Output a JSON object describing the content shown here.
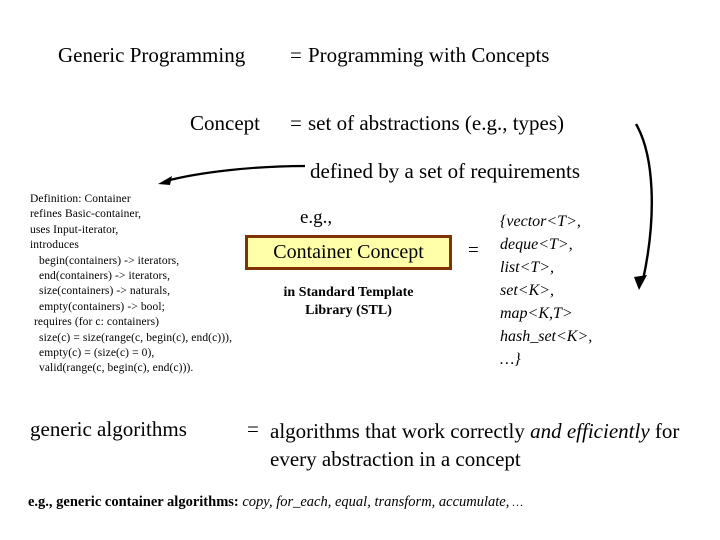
{
  "slide": {
    "background_color": "#ffffff",
    "text_color": "#000000"
  },
  "headline": {
    "term1": "Generic Programming",
    "equals1": "=",
    "definition1": "Programming with Concepts",
    "term2": "Concept",
    "equals2": "=",
    "definition2": "set of abstractions (e.g., types)",
    "definition2_cont": "defined by a set of requirements"
  },
  "definition_block": {
    "lines": [
      "Definition: Container",
      "refines Basic-container,",
      "uses Input-iterator,",
      "introduces",
      "begin(containers) -> iterators,",
      "end(containers) -> iterators,",
      "size(containers) -> naturals,",
      "empty(containers) -> bool;",
      "requires (for c: containers)",
      "size(c) = size(range(c, begin(c), end(c))),",
      "empty(c) = (size(c) = 0),",
      "valid(range(c, begin(c), end(c)))."
    ],
    "indents": [
      0,
      0,
      0,
      0,
      1,
      1,
      1,
      1,
      2,
      1,
      1,
      1
    ]
  },
  "example": {
    "eg_label": "e.g.,",
    "box_label": "Container Concept",
    "box_fill": "#ffffaa",
    "box_border": "#803300",
    "caption_line1": "in Standard Template",
    "caption_line2": "Library (STL)",
    "equals": "="
  },
  "type_list": {
    "items": [
      "{vector<T>,",
      "deque<T>,",
      "list<T>,",
      "set<K>,",
      "map<K,T>",
      "hash_set<K>,",
      "…}"
    ]
  },
  "bottom": {
    "term": "generic algorithms",
    "equals": "=",
    "text_part1": "algorithms that work correctly ",
    "text_italic": "and efficiently",
    "text_part2": " for every abstraction in a concept"
  },
  "footer": {
    "prefix": "e.g., generic container algorithms:",
    "examples": " copy, for_each, equal, transform, accumulate,",
    "ellipsis": " …"
  }
}
